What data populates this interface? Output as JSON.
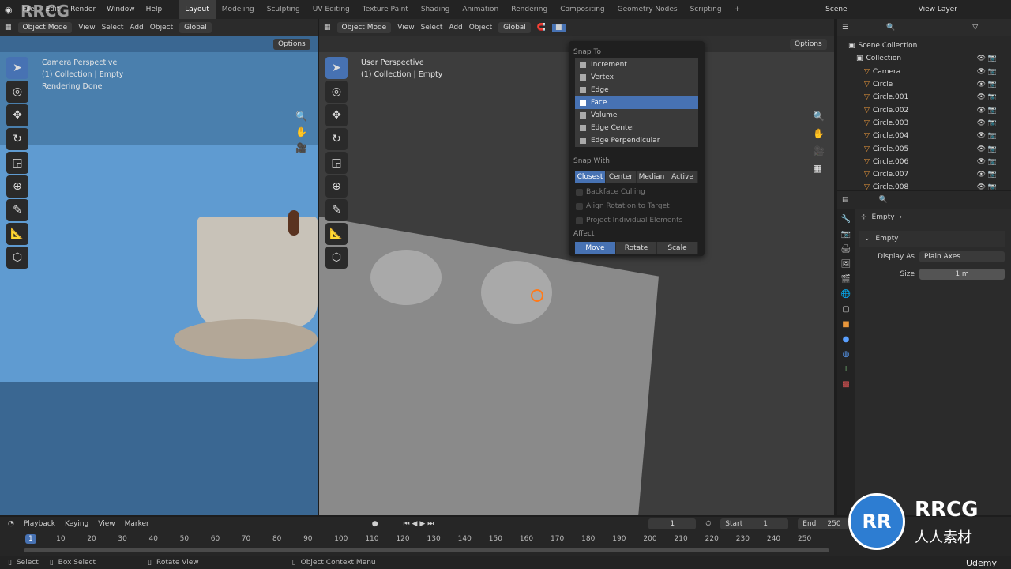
{
  "topbar": {
    "menus": [
      "File",
      "Edit",
      "Render",
      "Window",
      "Help"
    ],
    "workspaces": [
      "Layout",
      "Modeling",
      "Sculpting",
      "UV Editing",
      "Texture Paint",
      "Shading",
      "Animation",
      "Rendering",
      "Compositing",
      "Geometry Nodes",
      "Scripting"
    ],
    "active_workspace": "Layout",
    "scene": "Scene",
    "view_layer": "View Layer"
  },
  "left_view": {
    "mode": "Object Mode",
    "menus": [
      "View",
      "Select",
      "Add",
      "Object"
    ],
    "orientation": "Global",
    "options": "Options",
    "info": [
      "Camera Perspective",
      "(1) Collection | Empty",
      "Rendering Done"
    ]
  },
  "main_view": {
    "mode": "Object Mode",
    "menus": [
      "View",
      "Select",
      "Add",
      "Object"
    ],
    "orientation": "Global",
    "options": "Options",
    "info": [
      "User Perspective",
      "(1) Collection | Empty"
    ]
  },
  "snap": {
    "snap_to_label": "Snap To",
    "items": [
      "Increment",
      "Vertex",
      "Edge",
      "Face",
      "Volume",
      "Edge Center",
      "Edge Perpendicular"
    ],
    "active_item": "Face",
    "snap_with_label": "Snap With",
    "snap_with": [
      "Closest",
      "Center",
      "Median",
      "Active"
    ],
    "snap_with_active": "Closest",
    "options": [
      "Backface Culling",
      "Align Rotation to Target",
      "Project Individual Elements"
    ],
    "affect_label": "Affect",
    "affect": [
      "Move",
      "Rotate",
      "Scale"
    ],
    "affect_active": "Move"
  },
  "outliner": {
    "root": "Scene Collection",
    "collection": "Collection",
    "items": [
      "Camera",
      "Circle",
      "Circle.001",
      "Circle.002",
      "Circle.003",
      "Circle.004",
      "Circle.005",
      "Circle.006",
      "Circle.007",
      "Circle.008"
    ]
  },
  "properties": {
    "object": "Empty",
    "panel": "Empty",
    "display_as_label": "Display As",
    "display_as": "Plain Axes",
    "size_label": "Size",
    "size": "1 m"
  },
  "timeline": {
    "menus": [
      "Playback",
      "Keying",
      "View",
      "Marker"
    ],
    "current_frame": "1",
    "start_label": "Start",
    "start": "1",
    "end_label": "End",
    "end": "250",
    "ticks": [
      "1",
      "10",
      "20",
      "30",
      "40",
      "50",
      "60",
      "70",
      "80",
      "90",
      "100",
      "110",
      "120",
      "130",
      "140",
      "150",
      "160",
      "170",
      "180",
      "190",
      "200",
      "210",
      "220",
      "230",
      "240",
      "250"
    ]
  },
  "statusbar": {
    "items": [
      "Select",
      "Box Select",
      "Rotate View",
      "Object Context Menu"
    ]
  },
  "watermarks": {
    "rrcg": "RRCG",
    "cn": "人人素材",
    "udemy": "Udemy"
  }
}
